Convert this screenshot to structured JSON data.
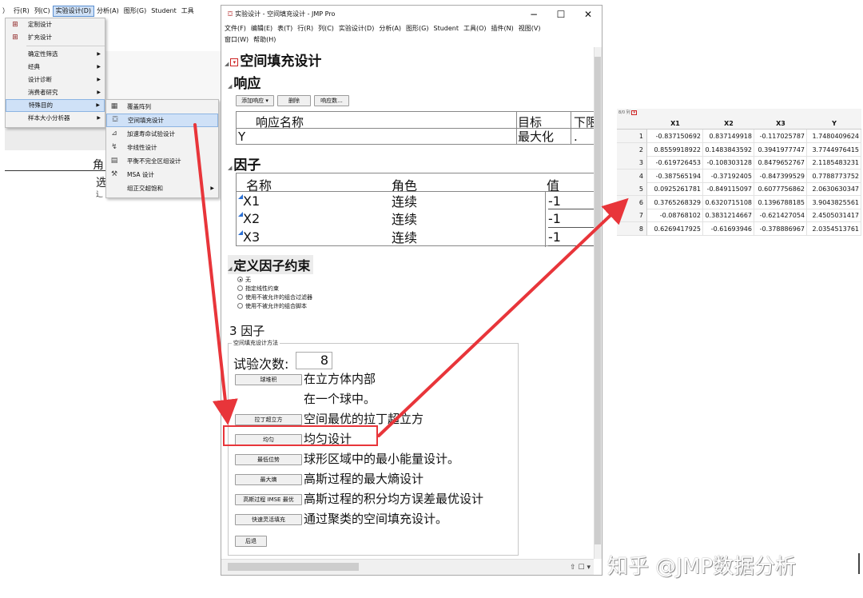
{
  "bg_menubar": [
    "）",
    "行(R)",
    "列(C)",
    "实验设计(D)",
    "分析(A)",
    "图形(G)",
    "Student",
    "工具"
  ],
  "bg_menu": [
    {
      "label": "定制设计",
      "icon": "custom-design-icon"
    },
    {
      "label": "扩充设计",
      "icon": "augment-design-icon"
    },
    {
      "label": "确定性筛选",
      "submenu": true
    },
    {
      "label": "经典",
      "submenu": true
    },
    {
      "label": "设计诊断",
      "submenu": true
    },
    {
      "label": "消费者研究",
      "submenu": true
    },
    {
      "label": "特殊目的",
      "submenu": true
    },
    {
      "label": "样本大小分析器",
      "submenu": true
    }
  ],
  "bg_submenu": [
    {
      "label": "覆盖阵列"
    },
    {
      "label": "空间填充设计"
    },
    {
      "label": "加速寿命试验设计"
    },
    {
      "label": "非线性设计"
    },
    {
      "label": "平衡不完全区组设计"
    },
    {
      "label": "MSA 设计"
    },
    {
      "label": "组正交超饱和"
    }
  ],
  "bg_fragments": [
    "角",
    "选",
    "辶"
  ],
  "window": {
    "title": "实验设计 - 空间填充设计 - JMP Pro",
    "minimize": "−",
    "maximize": "☐",
    "close": "✕",
    "menu_row1": [
      "文件(F)",
      "编辑(E)",
      "表(T)",
      "行(R)",
      "列(C)",
      "实验设计(D)",
      "分析(A)",
      "图形(G)",
      "Student",
      "工具(O)",
      "插件(N)",
      "视图(V)"
    ],
    "menu_row2": [
      "窗口(W)",
      "帮助(H)"
    ]
  },
  "platform_title": "空间填充设计",
  "responses": {
    "header": "响应",
    "buttons": {
      "add": "添加响应 ▾",
      "remove": "删除",
      "count": "响应数..."
    },
    "columns": [
      "响应名称",
      "目标",
      "下限"
    ],
    "rows": [
      {
        "name": "Y",
        "goal": "最大化",
        "lower": "."
      }
    ]
  },
  "factors": {
    "header": "因子",
    "columns": [
      "名称",
      "角色",
      "值"
    ],
    "rows": [
      {
        "name": "X1",
        "role": "连续",
        "value": "-1"
      },
      {
        "name": "X2",
        "role": "连续",
        "value": "-1"
      },
      {
        "name": "X3",
        "role": "连续",
        "value": "-1"
      }
    ]
  },
  "constraints": {
    "header": "定义因子约束",
    "options": [
      "无",
      "指定线性约束",
      "使用不被允许的组合过滤器",
      "使用不被允许的组合脚本"
    ],
    "selected": 0
  },
  "methods": {
    "factor_count_label": "3 因子",
    "group_label": "空间填充设计方法",
    "runs_label": "试验次数:",
    "runs_value": "8",
    "items": [
      {
        "button": "球堆积",
        "desc": "在立方体内部"
      },
      {
        "button": "",
        "desc": "在一个球中。"
      },
      {
        "button": "拉丁超立方",
        "desc": "空间最优的拉丁超立方"
      },
      {
        "button": "均匀",
        "desc": "均匀设计"
      },
      {
        "button": "最低位势",
        "desc": "球形区域中的最小能量设计。"
      },
      {
        "button": "最大熵",
        "desc": "高斯过程的最大熵设计"
      },
      {
        "button": "高斯过程 IMSE 最优",
        "desc": "高斯过程的积分均方误差最优设计"
      },
      {
        "button": "快速灵活填充",
        "desc": "通过聚类的空间填充设计。"
      }
    ],
    "back_button": "后退"
  },
  "status_icons": "⇧ ☐ ▾",
  "data_table": {
    "corner": "8/0 列",
    "columns": [
      "X1",
      "X2",
      "X3",
      "Y"
    ],
    "rows": [
      [
        "1",
        "-0.837150692",
        "0.837149918",
        "-0.117025787",
        "1.7480409624"
      ],
      [
        "2",
        "0.8559918922",
        "0.1483843592",
        "0.3941977747",
        "3.7744976415"
      ],
      [
        "3",
        "-0.619726453",
        "-0.108303128",
        "0.8479652767",
        "2.1185483231"
      ],
      [
        "4",
        "-0.387565194",
        "-0.37192405",
        "-0.847399529",
        "0.7788773752"
      ],
      [
        "5",
        "0.0925261781",
        "-0.849115097",
        "0.6077756862",
        "2.0630630347"
      ],
      [
        "6",
        "0.3765268329",
        "0.6320715108",
        "0.1396788185",
        "3.9043825561"
      ],
      [
        "7",
        "-0.08768102",
        "0.3831214667",
        "-0.621427054",
        "2.4505031417"
      ],
      [
        "8",
        "0.6269417925",
        "-0.61693946",
        "-0.378886967",
        "2.0354513761"
      ]
    ]
  },
  "watermark": "知乎 @JMP数据分析",
  "colors": {
    "accent_red": "#e8353a",
    "highlight": "#cfe1f7",
    "blue_marker": "#2a6fd3"
  }
}
